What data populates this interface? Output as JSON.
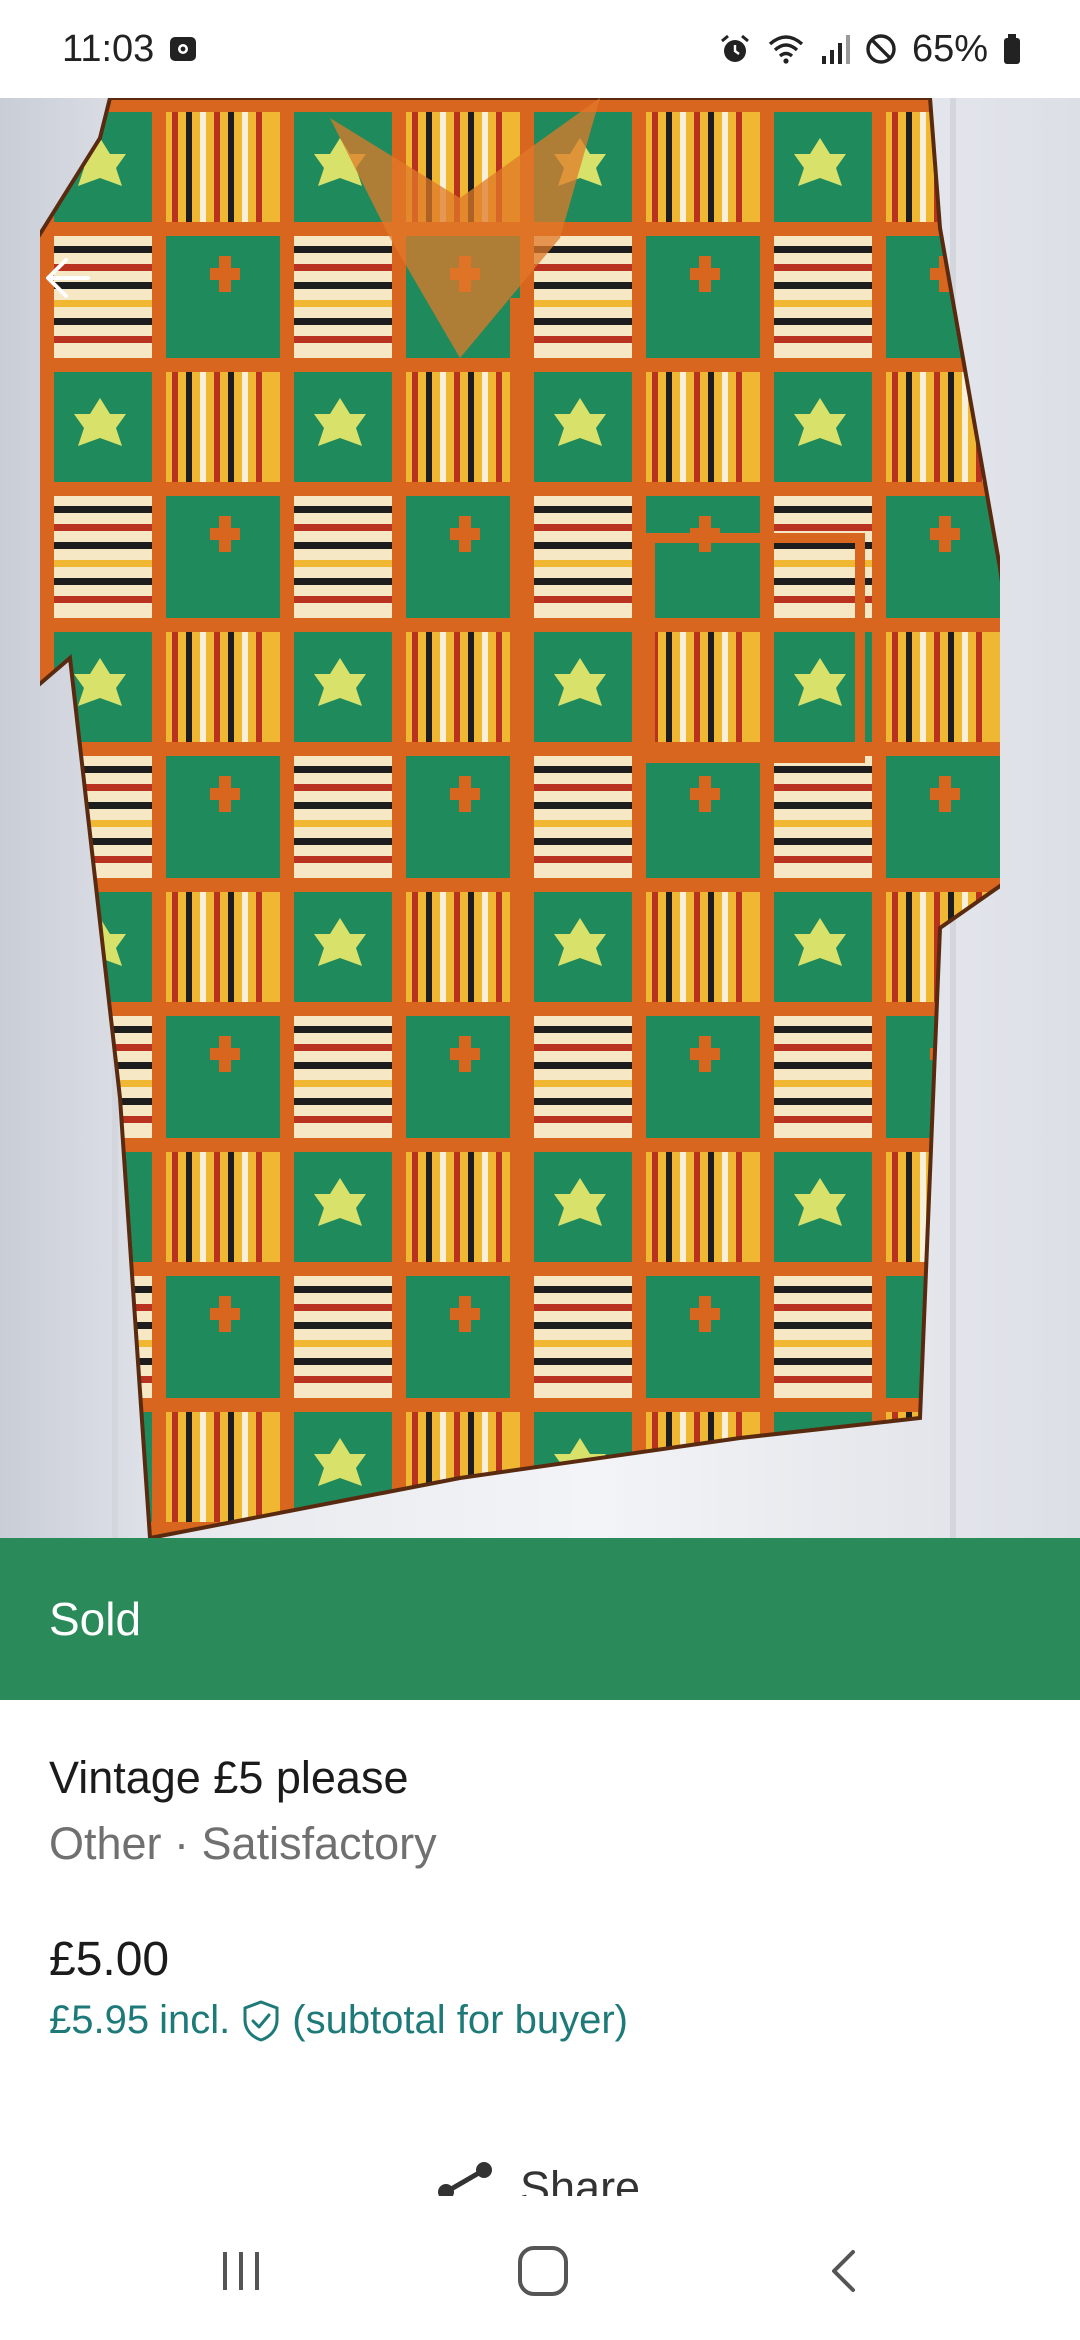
{
  "status_bar": {
    "time": "11:03",
    "battery": "65%",
    "icons": [
      "screenshot-icon",
      "alarm-icon",
      "wifi-icon",
      "signal-icon",
      "do-not-disturb-icon",
      "battery-icon"
    ]
  },
  "listing": {
    "status_banner": "Sold",
    "title": "Vintage £5 please",
    "subtitle": "Other · Satisfactory",
    "price": "£5.00",
    "buyer_price": "£5.95",
    "buyer_incl": "incl.",
    "buyer_note": "(subtotal for buyer)",
    "share_label": "Share"
  },
  "colors": {
    "banner": "#2a8a5a",
    "accent": "#1d7a78"
  },
  "icons": {
    "back": "back-arrow-icon",
    "protection": "shield-check-icon",
    "share": "share-icon",
    "nav_recents": "recents-icon",
    "nav_home": "home-icon",
    "nav_back": "back-icon"
  }
}
